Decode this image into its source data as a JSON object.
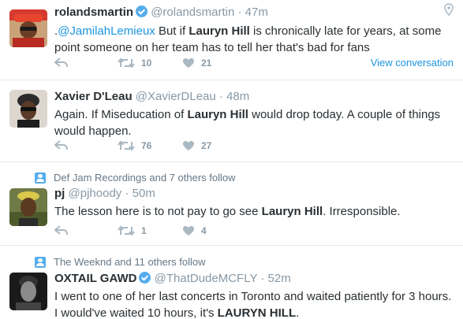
{
  "colors": {
    "link": "#1b95e0",
    "verified": "#55acee",
    "muted": "#8899a6",
    "divider": "#e1e8ed"
  },
  "tweets": [
    {
      "fullname": "rolandsmartin",
      "verified": true,
      "handle": "@rolandsmartin",
      "time": "47m",
      "text_parts": [
        ".",
        "@JamilahLemieux",
        " But if ",
        "Lauryn Hill",
        " is chronically late for years, at some point someone on her team has to tell her that's bad for fans"
      ],
      "retweets": "10",
      "likes": "21",
      "view_conversation": "View conversation"
    },
    {
      "fullname": "Xavier D'Leau",
      "handle": "@XavierDLeau",
      "time": "48m",
      "text_parts": [
        "Again. If Miseducation of ",
        "Lauryn Hill",
        " would drop today. A couple of things would happen."
      ],
      "retweets": "76",
      "likes": "27"
    },
    {
      "social_context": "Def Jam Recordings and 7 others follow",
      "fullname": "pj",
      "handle": "@pjhoody",
      "time": "50m",
      "text_parts": [
        "The lesson here is to not pay to go see ",
        "Lauryn Hill",
        ". Irresponsible."
      ],
      "retweets": "1",
      "likes": "4"
    },
    {
      "social_context": "The Weeknd and 11 others follow",
      "fullname": "OXTAIL GAWD",
      "verified": true,
      "handle": "@ThatDudeMCFLY",
      "time": "52m",
      "text_parts": [
        "I went to one of her last concerts in Toronto and waited patiently for 3 hours. I would've waited 10 hours, it's ",
        "LAURYN HILL",
        "."
      ]
    }
  ],
  "separator": "·",
  "icons": [
    "reply-icon",
    "retweet-icon",
    "like-icon",
    "location-pin-icon",
    "follow-context-icon",
    "verified-badge-icon"
  ]
}
